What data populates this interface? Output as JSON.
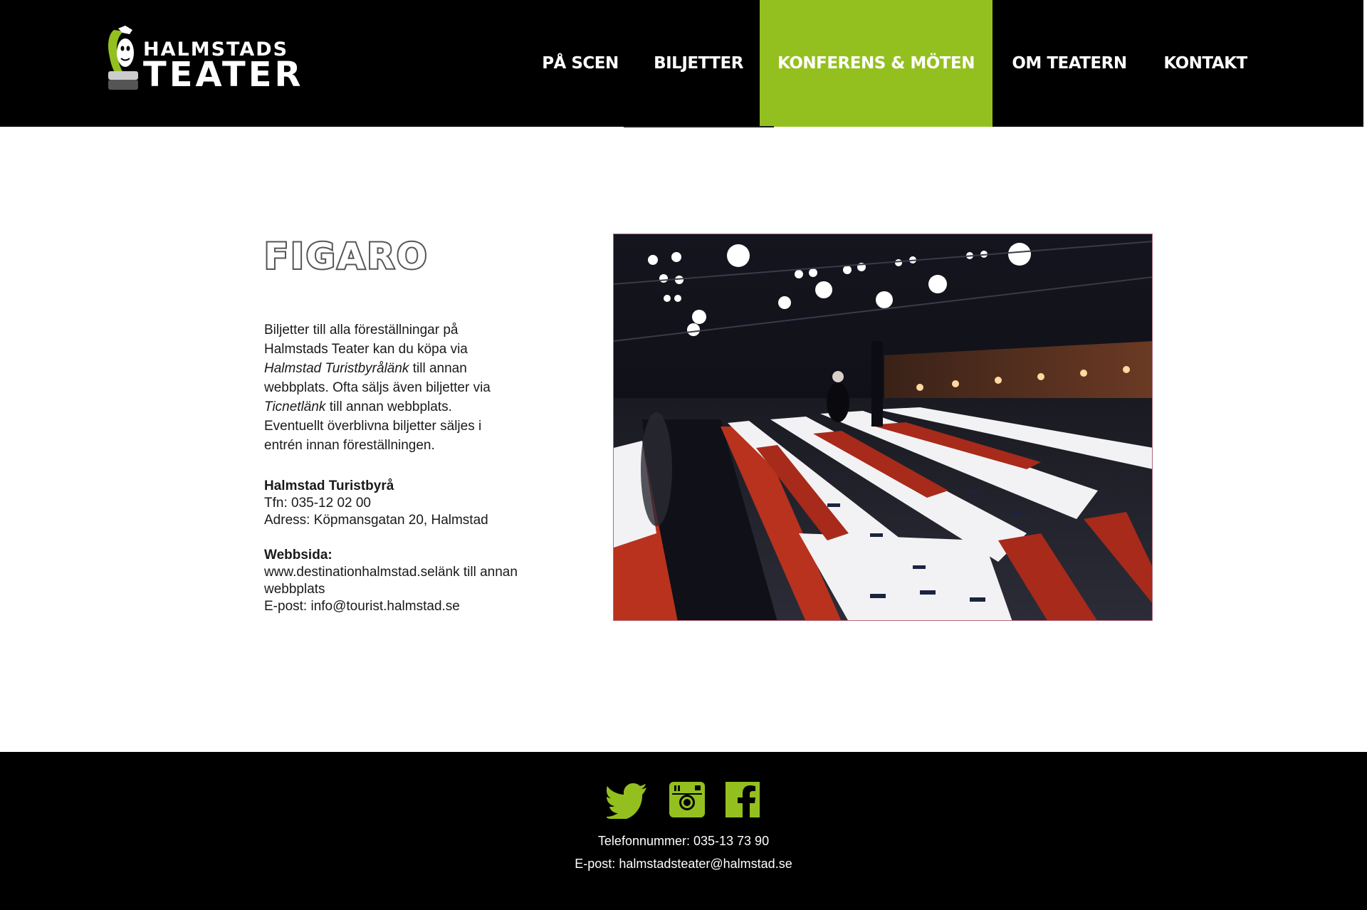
{
  "brand": {
    "logo_line1": "HALMSTADS",
    "logo_line2": "TEATER",
    "accent_color": "#94c01f"
  },
  "nav": {
    "items": [
      {
        "label": "PÅ SCEN"
      },
      {
        "label": "BILJETTER"
      },
      {
        "label": "KONFERENS & MÖTEN",
        "active": true
      },
      {
        "label": "OM TEATERN"
      },
      {
        "label": "KONTAKT"
      }
    ]
  },
  "main": {
    "title": "FIGARO",
    "intro": {
      "t1": "Biljetter till alla föreställningar på Halmstads Teater kan du köpa via ",
      "link1": "Halmstad Turistbyrålänk",
      "t2": " till annan webbplats. Ofta säljs även biljetter via ",
      "link2": "Ticnetlänk",
      "t3": " till annan webbplats. Eventuellt överblivna biljetter säljes i entrén innan föreställningen."
    },
    "contact": {
      "heading": "Halmstad Turistbyrå",
      "phone": "Tfn: 035-12 02 00",
      "address": "Adress: Köpmansgatan 20, Halmstad"
    },
    "web": {
      "heading": "Webbsida:",
      "url": "www.destinationhalmstad.selänk till annan webbplats",
      "email": "E-post: info@tourist.halmstad.se"
    }
  },
  "footer": {
    "social": [
      {
        "icon": "twitter-icon"
      },
      {
        "icon": "instagram-icon"
      },
      {
        "icon": "facebook-icon"
      }
    ],
    "phone_label": "Telefonnummer: ",
    "phone_value": "035-13 73 90",
    "email_label": "E-post: ",
    "email_value": "halmstadsteater@halmstad.se"
  }
}
